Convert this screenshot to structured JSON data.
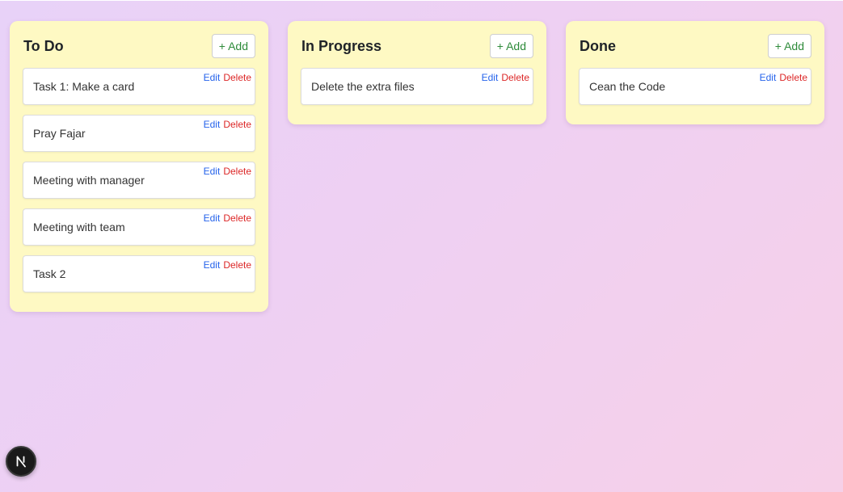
{
  "columns": [
    {
      "title": "To Do",
      "add_label": "+ Add",
      "cards": [
        {
          "text": "Task 1: Make a card",
          "edit": "Edit",
          "delete": "Delete"
        },
        {
          "text": "Pray Fajar",
          "edit": "Edit",
          "delete": "Delete"
        },
        {
          "text": "Meeting with manager",
          "edit": "Edit",
          "delete": "Delete"
        },
        {
          "text": "Meeting with team",
          "edit": "Edit",
          "delete": "Delete"
        },
        {
          "text": "Task 2",
          "edit": "Edit",
          "delete": "Delete"
        }
      ]
    },
    {
      "title": "In Progress",
      "add_label": "+ Add",
      "cards": [
        {
          "text": "Delete the extra files",
          "edit": "Edit",
          "delete": "Delete"
        }
      ]
    },
    {
      "title": "Done",
      "add_label": "+ Add",
      "cards": [
        {
          "text": "Cean the Code",
          "edit": "Edit",
          "delete": "Delete"
        }
      ]
    }
  ],
  "dev_badge": {
    "icon": "nextjs-logo-icon",
    "letter": "N"
  },
  "colors": {
    "column_bg": "#fef9c3",
    "add_text": "#2e8b3a",
    "edit_link": "#2563eb",
    "delete_link": "#dc2626"
  }
}
